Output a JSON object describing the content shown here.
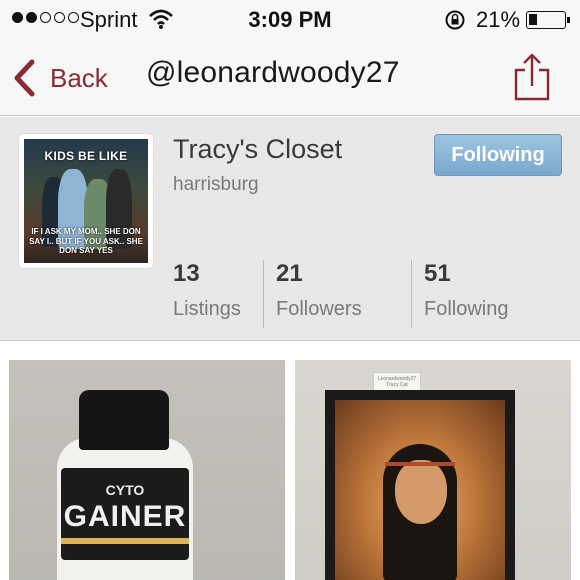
{
  "status_bar": {
    "carrier": "Sprint",
    "time": "3:09 PM",
    "battery_percent": "21%",
    "battery_level": 0.21,
    "signal_bars_filled": 2,
    "signal_bars_total": 5
  },
  "nav": {
    "back_label": "Back",
    "title": "@leonardwoody27",
    "accent_color": "#8a2a34"
  },
  "profile": {
    "closet_name": "Tracy's Closet",
    "location": "harrisburg",
    "follow_button_label": "Following",
    "avatar_text_top": "KIDS BE LIKE",
    "avatar_text_bottom": "IF I ASK MY MOM.. SHE DON SAY I.. BUT IF YOU ASK.. SHE DON SAY YES",
    "stats": [
      {
        "value": "13",
        "label": "Listings"
      },
      {
        "value": "21",
        "label": "Followers"
      },
      {
        "value": "51",
        "label": "Following"
      }
    ]
  },
  "listings": [
    {
      "product_text_small": "CYTO",
      "product_text_large": "GAINER"
    },
    {
      "tag_text": "Leonardwoody27 Tracy Cat"
    }
  ]
}
